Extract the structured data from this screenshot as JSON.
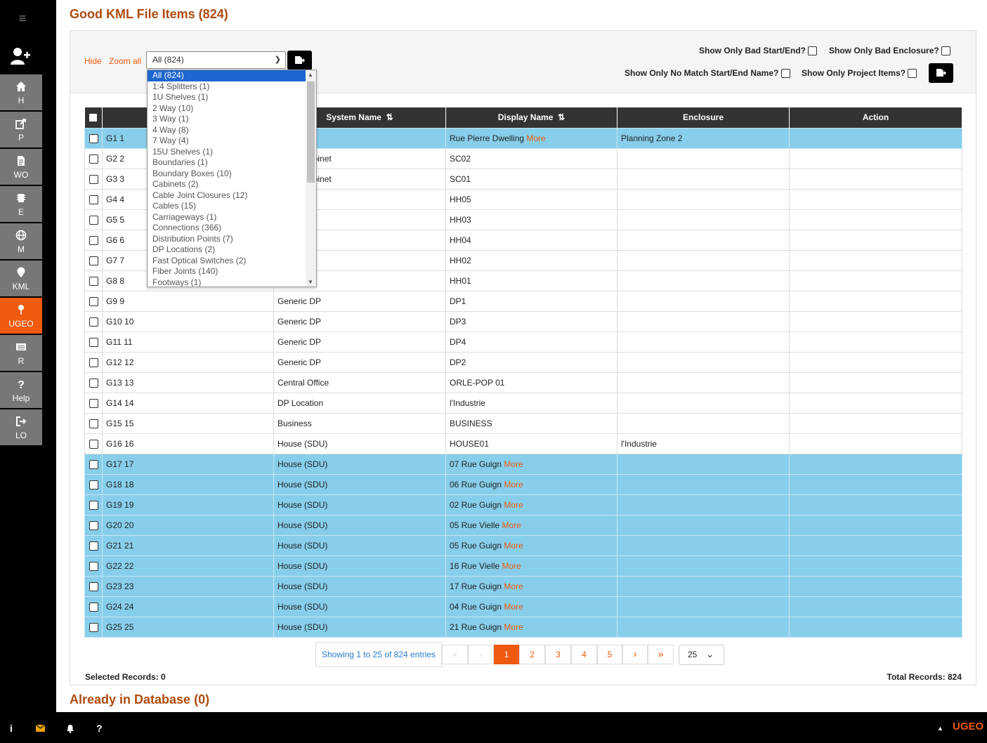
{
  "sidebar": {
    "items": [
      {
        "label": "H",
        "icon": "home-icon"
      },
      {
        "label": "P",
        "icon": "share-icon"
      },
      {
        "label": "WO",
        "icon": "document-icon"
      },
      {
        "label": "E",
        "icon": "chip-icon"
      },
      {
        "label": "M",
        "icon": "globe-icon"
      },
      {
        "label": "KML",
        "icon": "map-pin-icon"
      },
      {
        "label": "UGEO",
        "icon": "pin-icon",
        "active": true
      },
      {
        "label": "R",
        "icon": "list-icon"
      },
      {
        "label": "Help",
        "icon": "question-icon"
      },
      {
        "label": "LO",
        "icon": "logout-icon"
      }
    ],
    "accent": "#ee5a0e"
  },
  "page": {
    "title": "Good KML File Items (824)",
    "section2_title": "Already in Database (0)"
  },
  "toolbar": {
    "hide": "Hide",
    "zoom_all": "Zoom all",
    "select_value": "All (824)"
  },
  "filters": {
    "bad_start_end": "Show Only Bad Start/End?",
    "bad_enclosure": "Show Only Bad Enclosure?",
    "no_match": "Show Only No Match Start/End Name?",
    "project_items": "Show Only Project Items?"
  },
  "dropdown": {
    "options": [
      "All (824)",
      "1:4 Splitters (1)",
      "1U Shelves (1)",
      "2 Way (10)",
      "3 Way (1)",
      "4 Way (8)",
      "7 Way (4)",
      "15U Shelves (1)",
      "Boundaries (1)",
      "Boundary Boxes (10)",
      "Cabinets (2)",
      "Cable Joint Closures (12)",
      "Cables (15)",
      "Carriageways (1)",
      "Connections (366)",
      "Distribution Points (7)",
      "DP Locations (2)",
      "Fast Optical Switches (2)",
      "Fiber Joints (140)",
      "Footways (1)"
    ]
  },
  "table": {
    "headers": [
      "",
      "",
      "System Name",
      "Display Name",
      "Enclosure",
      "Action"
    ],
    "more": "More",
    "rows": [
      {
        "id": "G1 1",
        "sys": "",
        "disp": "Rue Pierre Dwelling",
        "more": true,
        "enc": "Planning Zone 2",
        "hl": true
      },
      {
        "id": "G2 2",
        "sys": "Street Cabinet",
        "disp": "SC02",
        "more": false,
        "enc": "",
        "hl": false
      },
      {
        "id": "G3 3",
        "sys": "Street Cabinet",
        "disp": "SC01",
        "more": false,
        "enc": "",
        "hl": false
      },
      {
        "id": "G4 4",
        "sys": "",
        "disp": "HH05",
        "more": false,
        "enc": "",
        "hl": false
      },
      {
        "id": "G5 5",
        "sys": "",
        "disp": "HH03",
        "more": false,
        "enc": "",
        "hl": false
      },
      {
        "id": "G6 6",
        "sys": "",
        "disp": "HH04",
        "more": false,
        "enc": "",
        "hl": false
      },
      {
        "id": "G7 7",
        "sys": "",
        "disp": "HH02",
        "more": false,
        "enc": "",
        "hl": false
      },
      {
        "id": "G8 8",
        "sys": "",
        "disp": "HH01",
        "more": false,
        "enc": "",
        "hl": false
      },
      {
        "id": "G9 9",
        "sys": "Generic DP",
        "disp": "DP1",
        "more": false,
        "enc": "",
        "hl": false
      },
      {
        "id": "G10 10",
        "sys": "Generic DP",
        "disp": "DP3",
        "more": false,
        "enc": "",
        "hl": false
      },
      {
        "id": "G11 11",
        "sys": "Generic DP",
        "disp": "DP4",
        "more": false,
        "enc": "",
        "hl": false
      },
      {
        "id": "G12 12",
        "sys": "Generic DP",
        "disp": "DP2",
        "more": false,
        "enc": "",
        "hl": false
      },
      {
        "id": "G13 13",
        "sys": "Central Office",
        "disp": "ORLE-POP 01",
        "more": false,
        "enc": "",
        "hl": false
      },
      {
        "id": "G14 14",
        "sys": "DP Location",
        "disp": "l'Industrie",
        "more": false,
        "enc": "",
        "hl": false
      },
      {
        "id": "G15 15",
        "sys": "Business",
        "disp": "BUSINESS",
        "more": false,
        "enc": "",
        "hl": false
      },
      {
        "id": "G16 16",
        "sys": "House (SDU)",
        "disp": "HOUSE01",
        "more": false,
        "enc": "l'Industrie",
        "hl": false
      },
      {
        "id": "G17 17",
        "sys": "House (SDU)",
        "disp": "07 Rue Guign",
        "more": true,
        "enc": "",
        "hl": true
      },
      {
        "id": "G18 18",
        "sys": "House (SDU)",
        "disp": "06 Rue Guign",
        "more": true,
        "enc": "",
        "hl": true
      },
      {
        "id": "G19 19",
        "sys": "House (SDU)",
        "disp": "02 Rue Guign",
        "more": true,
        "enc": "",
        "hl": true
      },
      {
        "id": "G20 20",
        "sys": "House (SDU)",
        "disp": "05 Rue Vielle",
        "more": true,
        "enc": "",
        "hl": true
      },
      {
        "id": "G21 21",
        "sys": "House (SDU)",
        "disp": "05 Rue Guign",
        "more": true,
        "enc": "",
        "hl": true
      },
      {
        "id": "G22 22",
        "sys": "House (SDU)",
        "disp": "16 Rue Vielle",
        "more": true,
        "enc": "",
        "hl": true
      },
      {
        "id": "G23 23",
        "sys": "House (SDU)",
        "disp": "17 Rue Guign",
        "more": true,
        "enc": "",
        "hl": true
      },
      {
        "id": "G24 24",
        "sys": "House (SDU)",
        "disp": "04 Rue Guign",
        "more": true,
        "enc": "",
        "hl": true
      },
      {
        "id": "G25 25",
        "sys": "House (SDU)",
        "disp": "21 Rue Guign",
        "more": true,
        "enc": "",
        "hl": true
      }
    ]
  },
  "pagination": {
    "info": "Showing 1 to 25 of 824 entries",
    "first": "«",
    "prev": "‹",
    "pages": [
      "1",
      "2",
      "3",
      "4",
      "5"
    ],
    "next": "›",
    "last": "»",
    "page_size": "25"
  },
  "footer": {
    "selected": "Selected Records: 0",
    "total": "Total Records: 824"
  },
  "bottombar": {
    "brand": "UGEO"
  }
}
